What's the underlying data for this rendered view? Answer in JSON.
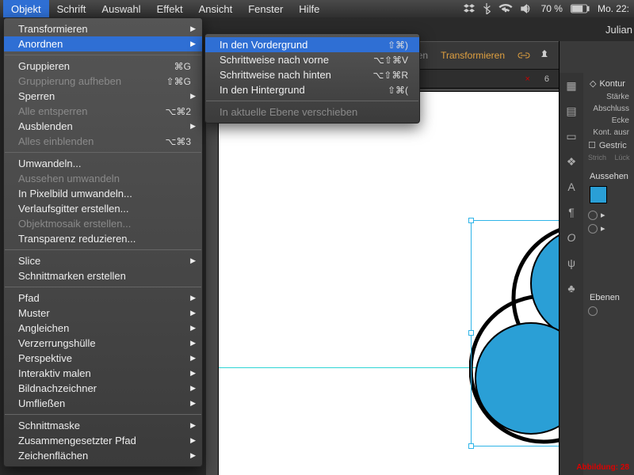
{
  "menubar": {
    "items": [
      "Objekt",
      "Schrift",
      "Auswahl",
      "Effekt",
      "Ansicht",
      "Fenster",
      "Hilfe"
    ],
    "active_index": 0
  },
  "status": {
    "battery": "70 %",
    "clock": "Mo. 22:"
  },
  "titlebar": {
    "user": "Julian"
  },
  "controlbar": {
    "align": "Ausrichten",
    "transform": "Transformieren"
  },
  "doctab": {
    "number": "6",
    "x_symbol": "×"
  },
  "menu1": {
    "groups": [
      [
        {
          "label": "Transformieren",
          "arrow": true
        },
        {
          "label": "Anordnen",
          "arrow": true,
          "highlight": true
        }
      ],
      [
        {
          "label": "Gruppieren",
          "shortcut": "⌘G"
        },
        {
          "label": "Gruppierung aufheben",
          "shortcut": "⇧⌘G",
          "disabled": true
        },
        {
          "label": "Sperren",
          "arrow": true
        },
        {
          "label": "Alle entsperren",
          "shortcut": "⌥⌘2",
          "disabled": true
        },
        {
          "label": "Ausblenden",
          "arrow": true
        },
        {
          "label": "Alles einblenden",
          "shortcut": "⌥⌘3",
          "disabled": true
        }
      ],
      [
        {
          "label": "Umwandeln..."
        },
        {
          "label": "Aussehen umwandeln",
          "disabled": true
        },
        {
          "label": "In Pixelbild umwandeln..."
        },
        {
          "label": "Verlaufsgitter erstellen..."
        },
        {
          "label": "Objektmosaik erstellen...",
          "disabled": true
        },
        {
          "label": "Transparenz reduzieren..."
        }
      ],
      [
        {
          "label": "Slice",
          "arrow": true
        },
        {
          "label": "Schnittmarken erstellen"
        }
      ],
      [
        {
          "label": "Pfad",
          "arrow": true
        },
        {
          "label": "Muster",
          "arrow": true
        },
        {
          "label": "Angleichen",
          "arrow": true
        },
        {
          "label": "Verzerrungshülle",
          "arrow": true
        },
        {
          "label": "Perspektive",
          "arrow": true
        },
        {
          "label": "Interaktiv malen",
          "arrow": true
        },
        {
          "label": "Bildnachzeichner",
          "arrow": true
        },
        {
          "label": "Umfließen",
          "arrow": true
        }
      ],
      [
        {
          "label": "Schnittmaske",
          "arrow": true
        },
        {
          "label": "Zusammengesetzter Pfad",
          "arrow": true
        },
        {
          "label": "Zeichenflächen",
          "arrow": true
        }
      ]
    ]
  },
  "menu2": {
    "groups": [
      [
        {
          "label": "In den Vordergrund",
          "shortcut": "⇧⌘)",
          "highlight": true
        },
        {
          "label": "Schrittweise nach vorne",
          "shortcut": "⌥⇧⌘V"
        },
        {
          "label": "Schrittweise nach hinten",
          "shortcut": "⌥⇧⌘R"
        },
        {
          "label": "In den Hintergrund",
          "shortcut": "⇧⌘("
        }
      ],
      [
        {
          "label": "In aktuelle Ebene verschieben",
          "disabled": true
        }
      ]
    ]
  },
  "rpanel": {
    "kontur_hdr": "Kontur",
    "labels": [
      "Stärke",
      "Abschluss",
      "Ecke",
      "Kont. ausr"
    ],
    "gestric": "Gestric",
    "strich": "Strich",
    "lucke": "Lück",
    "aussehen_hdr": "Aussehen",
    "ebenen_hdr": "Ebenen",
    "caption": "Abbildung: 28"
  }
}
